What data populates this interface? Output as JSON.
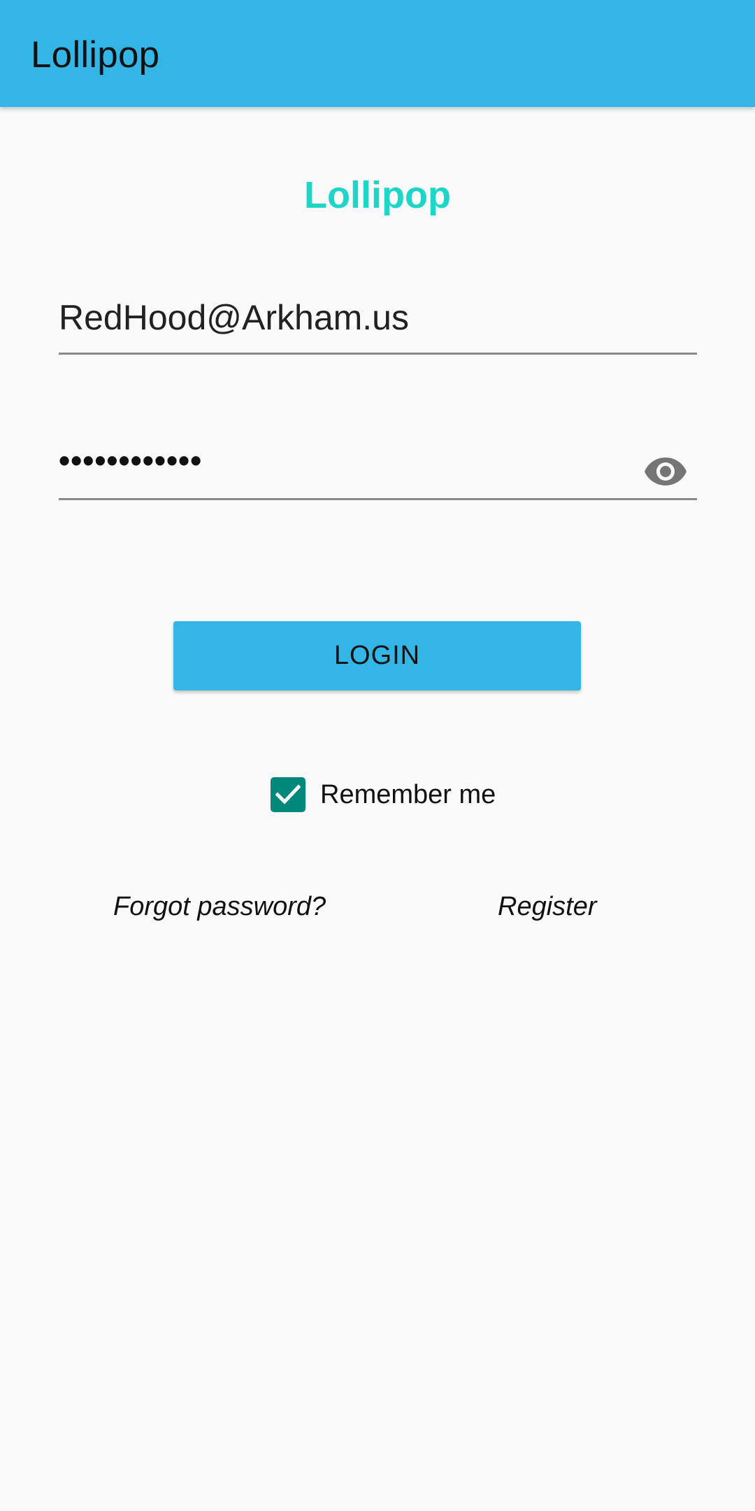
{
  "app_bar": {
    "title": "Lollipop",
    "color": "#33B5E5"
  },
  "brand": {
    "title": "Lollipop",
    "color": "#1DD6C7"
  },
  "email_field": {
    "value": "RedHood@Arkham.us"
  },
  "password_field": {
    "masked_value": "••••••••••••",
    "toggle_icon": "eye-icon"
  },
  "login_button": {
    "label": "LOGIN"
  },
  "remember_me": {
    "label": "Remember me",
    "checked": true,
    "color": "#00897B"
  },
  "links": {
    "forgot_password": "Forgot password?",
    "register": "Register"
  }
}
